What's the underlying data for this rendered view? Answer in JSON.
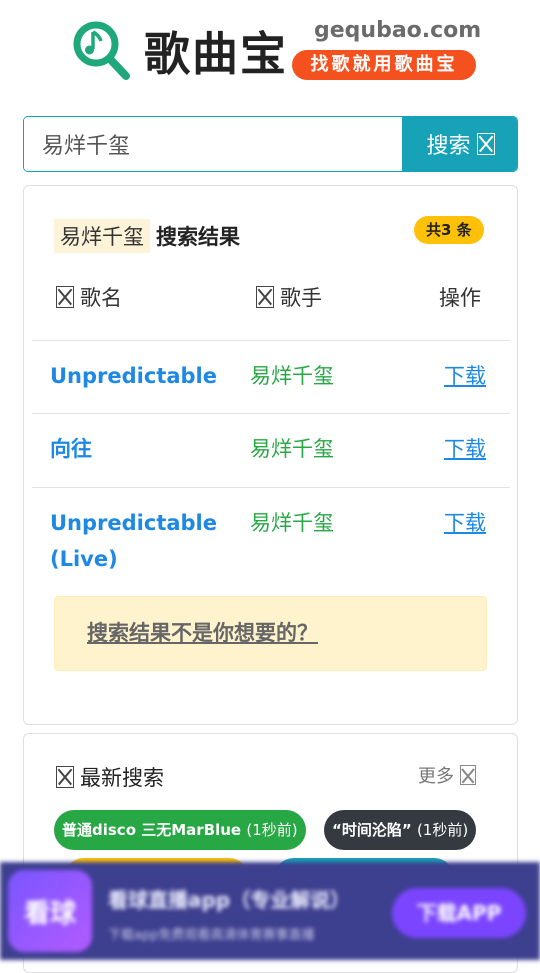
{
  "header": {
    "title": "歌曲宝",
    "domain": "gequbao.com",
    "slogan": "找歌就用歌曲宝"
  },
  "search": {
    "value": "易烊千玺",
    "button_label": "搜索"
  },
  "results": {
    "keyword": "易烊千玺",
    "label": "搜索结果",
    "count": "共3 条",
    "columns": {
      "song": "歌名",
      "artist": "歌手",
      "action": "操作"
    },
    "rows": [
      {
        "song": "Unpredictable",
        "artist": "易烊千玺",
        "action": "下载"
      },
      {
        "song": "向往",
        "artist": "易烊千玺",
        "action": "下载"
      },
      {
        "song": "Unpredictable (Live)",
        "artist": "易烊千玺",
        "action": "下载"
      }
    ],
    "notice": "搜索结果不是你想要的？"
  },
  "latest": {
    "title": "最新搜索",
    "more": "更多",
    "chips": [
      {
        "text": "普通disco 三无MarBlue",
        "time": "(1秒前)"
      },
      {
        "text": "“时间沦陷”",
        "time": "(1秒前)"
      }
    ]
  },
  "ad": {
    "icon_text": "看球",
    "title": "看球直播app（专业解说）",
    "subtitle": "下载app免费观看高清体育赛事直播",
    "button": "下载APP"
  },
  "colors": {
    "teal": "#17a2b8",
    "blue": "#1e88e5",
    "green": "#28a745",
    "orange": "#f4511e",
    "yellow": "#ffc107",
    "dark": "#343a40"
  }
}
